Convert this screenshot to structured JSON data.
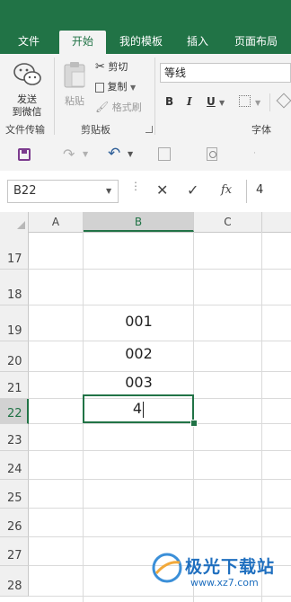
{
  "ribbon": {
    "tabs": [
      {
        "label": "文件"
      },
      {
        "label": "开始"
      },
      {
        "label": "我的模板"
      },
      {
        "label": "插入"
      },
      {
        "label": "页面布局"
      }
    ],
    "send_wechat": {
      "line1": "发送",
      "line2": "到微信",
      "group": "文件传输"
    },
    "paste": {
      "label": "粘贴"
    },
    "cut": {
      "label": "剪切"
    },
    "copy": {
      "label": "复制"
    },
    "format_painter": {
      "label": "格式刷"
    },
    "clipboard_group": "剪贴板",
    "font_name": "等线",
    "bold": "B",
    "italic": "I",
    "underline": "U",
    "font_group": "字体"
  },
  "formula_bar": {
    "name_box": "B22",
    "value": "4",
    "fx": "fx"
  },
  "grid": {
    "columns": [
      "A",
      "B",
      "C"
    ],
    "selected_column": "B",
    "rows": [
      {
        "num": "17",
        "b": ""
      },
      {
        "num": "18",
        "b": ""
      },
      {
        "num": "19",
        "b": "001"
      },
      {
        "num": "20",
        "b": "002"
      },
      {
        "num": "21",
        "b": "003"
      },
      {
        "num": "22",
        "b": "4"
      },
      {
        "num": "23",
        "b": ""
      },
      {
        "num": "24",
        "b": ""
      },
      {
        "num": "25",
        "b": ""
      },
      {
        "num": "26",
        "b": ""
      },
      {
        "num": "27",
        "b": ""
      },
      {
        "num": "28",
        "b": ""
      }
    ],
    "active_row": "22"
  },
  "watermark": {
    "text": "极光下载站",
    "url": "www.xz7.com"
  },
  "colors": {
    "accent": "#217346",
    "ribbon_bg": "#f3f3f3"
  }
}
